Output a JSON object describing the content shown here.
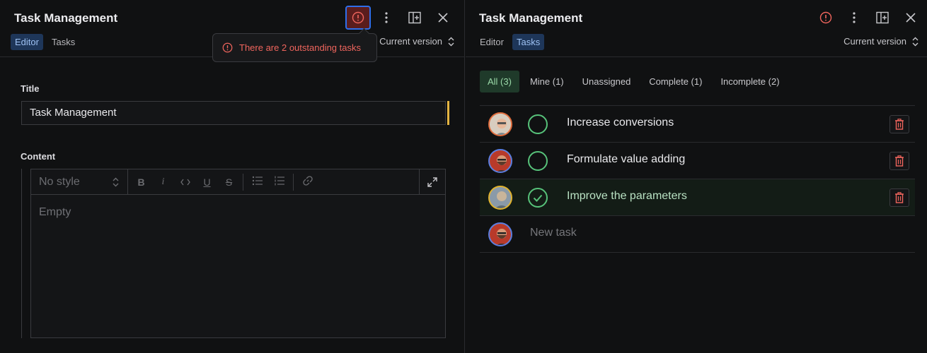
{
  "left": {
    "title": "Task Management",
    "tabs": [
      {
        "label": "Editor",
        "selected": true
      },
      {
        "label": "Tasks",
        "selected": false
      }
    ],
    "version_label": "Current version",
    "tooltip": "There are 2 outstanding tasks",
    "title_field": {
      "label": "Title",
      "value": "Task Management"
    },
    "content_field": {
      "label": "Content",
      "style_select": "No style",
      "placeholder": "Empty"
    }
  },
  "right": {
    "title": "Task Management",
    "tabs": [
      {
        "label": "Editor",
        "selected": false
      },
      {
        "label": "Tasks",
        "selected": true
      }
    ],
    "version_label": "Current version",
    "filters": [
      {
        "label": "All (3)",
        "selected": true
      },
      {
        "label": "Mine (1)",
        "selected": false
      },
      {
        "label": "Unassigned",
        "selected": false
      },
      {
        "label": "Complete (1)",
        "selected": false
      },
      {
        "label": "Incomplete (2)",
        "selected": false
      }
    ],
    "tasks": [
      {
        "text": "Increase conversions",
        "complete": false
      },
      {
        "text": "Formulate value adding",
        "complete": false
      },
      {
        "text": "Improve the parameters",
        "complete": true
      }
    ],
    "new_task_placeholder": "New task"
  },
  "colors": {
    "accent_blue": "#2f6feb",
    "warning_red": "#f0655d",
    "complete_green": "#57c27a",
    "cursor_yellow": "#e3b341"
  }
}
